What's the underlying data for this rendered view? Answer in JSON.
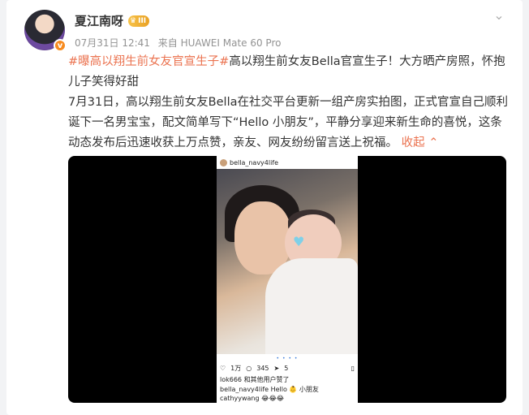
{
  "post": {
    "author": "夏江南呀",
    "badge_label": "III",
    "verified_mark": "v",
    "date": "07月31日 12:41",
    "source": "来自 HUAWEI Mate 60 Pro",
    "topic1": "#曝高以翔生前女友官宣生子#",
    "headline": "高以翔生前女友Bella官宣生子！大方晒产房照，怀抱儿子笑得好甜",
    "body": "7月31日，高以翔生前女友Bella在社交平台更新一组产房实拍图，正式官宣自己顺利诞下一名男宝宝，配文简单写下“Hello 小朋友”，平静分享迎来新生命的喜悦，这条动态发布后迅速收获上万点赞，亲友、网友纷纷留言送上祝福。",
    "collapse_label": "收起",
    "more_icon": "chevron-down-icon"
  },
  "media": {
    "ig_username": "bella_navy4life",
    "likes": "1万",
    "comments": "345",
    "shares": "5",
    "liked_by": "lok666 和其他用户赞了",
    "caption": "bella_navy4life Hello 👶 小朋友",
    "commenter": "cathyywang 😂😂😂"
  },
  "colors": {
    "accent": "#eb7350",
    "meta": "#939393"
  }
}
